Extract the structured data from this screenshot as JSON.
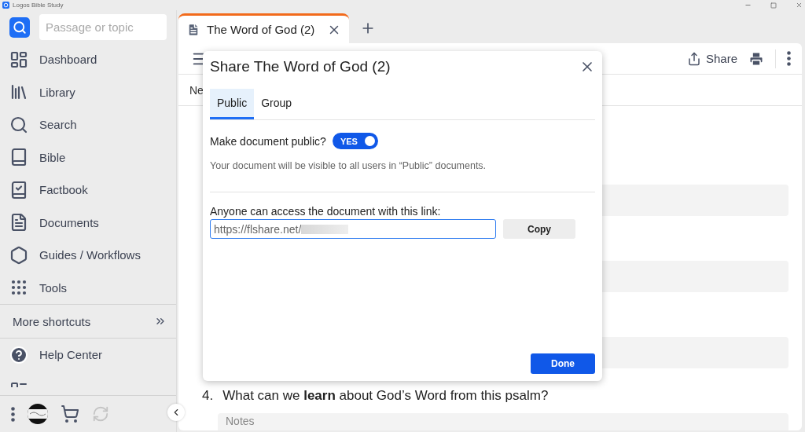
{
  "app_title": "Logos Bible Study",
  "search": {
    "placeholder": "Passage or topic"
  },
  "nav": [
    {
      "kind": "dashboard",
      "label": "Dashboard"
    },
    {
      "kind": "library",
      "label": "Library"
    },
    {
      "kind": "search",
      "label": "Search"
    },
    {
      "kind": "bible",
      "label": "Bible"
    },
    {
      "kind": "factbook",
      "label": "Factbook"
    },
    {
      "kind": "documents",
      "label": "Documents"
    },
    {
      "kind": "guides",
      "label": "Guides / Workflows"
    },
    {
      "kind": "tools",
      "label": "Tools"
    }
  ],
  "more_shortcuts": "More shortcuts",
  "help": "Help Center",
  "tabs": [
    {
      "label": "The Word of God (2)",
      "selected": true
    }
  ],
  "toolbar": {
    "share": "Share"
  },
  "doc_row": "Ne",
  "questions": [
    {
      "number": "4.",
      "text": "What can we **learn** about God’s Word from this psalm?",
      "notes_placeholder": "Notes"
    }
  ],
  "dialog": {
    "title": "Share The Word of God (2)",
    "tabs": [
      {
        "label": "Public",
        "selected": true
      },
      {
        "label": "Group",
        "selected": false
      }
    ],
    "public_question": "Make document public?",
    "toggle": {
      "label": "YES",
      "on": true
    },
    "note": "Your document will be visible to all users in “Public” documents.",
    "link_label": "Anyone can access the document with this link:",
    "link": "https://flshare.net/",
    "copy": "Copy",
    "done": "Done"
  }
}
